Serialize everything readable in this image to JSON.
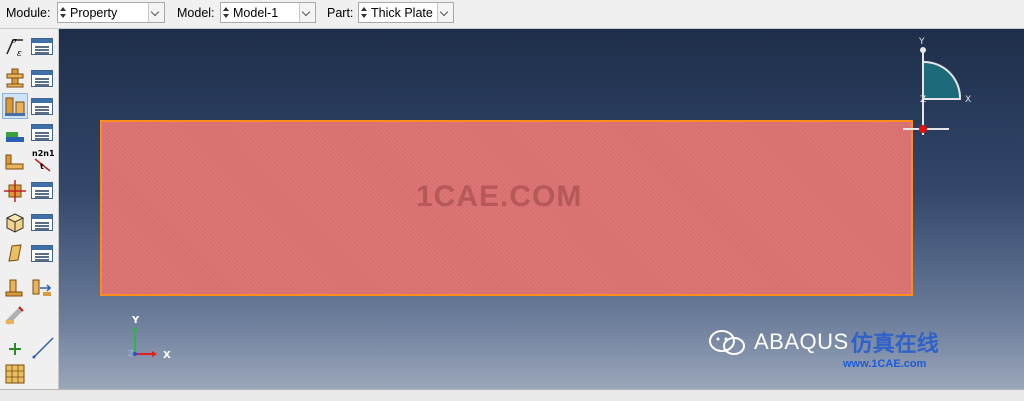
{
  "context_bar": {
    "module_label": "Module:",
    "module_value": "Property",
    "model_label": "Model:",
    "model_value": "Model-1",
    "part_label": "Part:",
    "part_value": "Thick Plate"
  },
  "toolbox": {
    "tools": [
      "create-material-icon",
      "material-manager-icon",
      "create-section-icon",
      "section-manager-icon",
      "assign-section-icon",
      "section-assignment-manager-icon",
      "create-profile-icon",
      "profile-manager-icon",
      "assign-beam-orientation-icon",
      "assign-normal-direction-icon",
      "assign-material-orientation-icon",
      "orientation-manager-icon",
      "create-composite-layup-icon",
      "layup-manager-icon",
      "create-skin-icon",
      "stringer-manager-icon",
      "special-inertia-icon",
      "springs-dashpots-icon",
      "assign-rebar-icon",
      "datum-point-icon",
      "datum-axis-icon",
      "partition-icon"
    ]
  },
  "viewport": {
    "watermark": "1CAE.COM",
    "view_triad": {
      "y": "Y",
      "z": "Z",
      "x": "X"
    },
    "global_triad": {
      "y": "Y",
      "z": "Z",
      "x": "X"
    },
    "plate_color": "#d97070",
    "plate_outline": "#ff8c1a",
    "logo_text": "ABAQUS",
    "logo_cn": "仿真在线",
    "logo_url": "www.1CAE.com"
  }
}
